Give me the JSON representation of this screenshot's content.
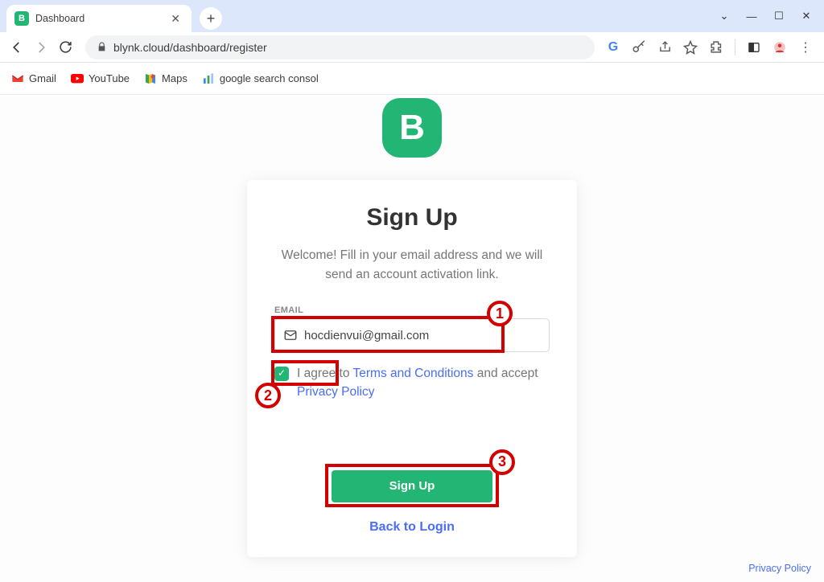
{
  "browser": {
    "tab_title": "Dashboard",
    "tab_favicon_letter": "B",
    "url": "blynk.cloud/dashboard/register"
  },
  "bookmarks": {
    "gmail": "Gmail",
    "youtube": "YouTube",
    "maps": "Maps",
    "gsc": "google search consol"
  },
  "logo_letter": "B",
  "form": {
    "title": "Sign Up",
    "subtitle": "Welcome! Fill in your email address and we will send an account activation link.",
    "email_label": "EMAIL",
    "email_value": "hocdienvui@gmail.com",
    "terms_prefix": "I agree to ",
    "terms_link": "Terms and Conditions",
    "terms_mid": " and accept ",
    "privacy_link": "Privacy Policy",
    "submit_label": "Sign Up",
    "back_label": "Back to Login"
  },
  "footer": {
    "privacy": "Privacy Policy"
  },
  "annot": {
    "n1": "1",
    "n2": "2",
    "n3": "3"
  }
}
